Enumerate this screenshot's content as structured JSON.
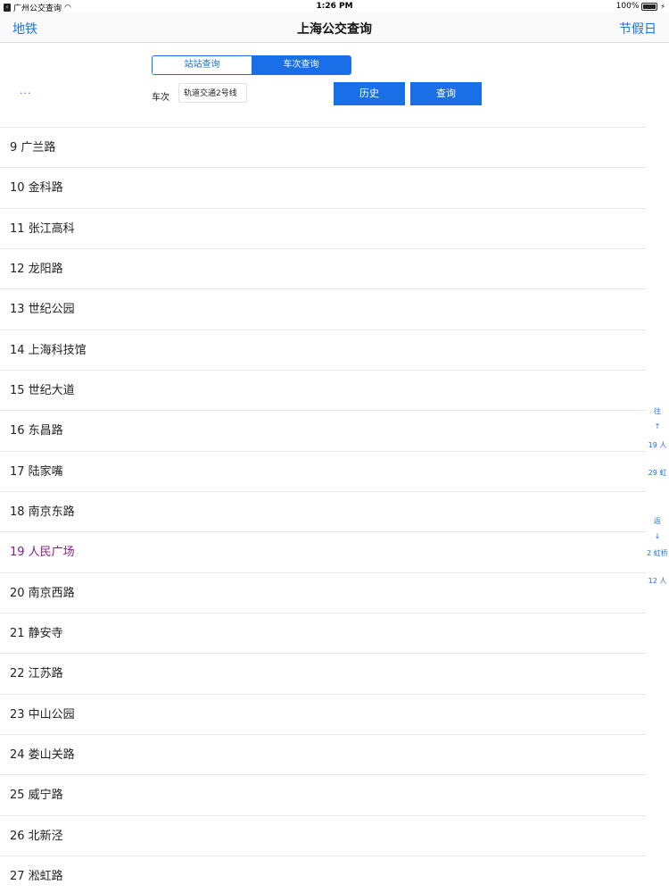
{
  "status_bar": {
    "back_app": "广州公交查询",
    "time": "1:26 PM",
    "battery": "100%"
  },
  "nav": {
    "left": "地铁",
    "title": "上海公交查询",
    "right": "节假日"
  },
  "query": {
    "tabs": [
      {
        "label": "站站查询",
        "active": false
      },
      {
        "label": "车次查询",
        "active": true
      }
    ],
    "more": "···",
    "field_label": "车次",
    "field_value": "轨道交通2号线",
    "history_button": "历史",
    "search_button": "查询"
  },
  "stations": [
    {
      "label": "9 广兰路"
    },
    {
      "label": "10 金科路"
    },
    {
      "label": "11 张江高科"
    },
    {
      "label": "12 龙阳路"
    },
    {
      "label": "13 世纪公园"
    },
    {
      "label": "14 上海科技馆"
    },
    {
      "label": "15 世纪大道"
    },
    {
      "label": "16 东昌路"
    },
    {
      "label": "17 陆家嘴"
    },
    {
      "label": "18 南京东路"
    },
    {
      "label": "19 人民广场",
      "highlight": true
    },
    {
      "label": "20 南京西路"
    },
    {
      "label": "21 静安寺"
    },
    {
      "label": "22 江苏路"
    },
    {
      "label": "23 中山公园"
    },
    {
      "label": "24 娄山关路"
    },
    {
      "label": "25 威宁路"
    },
    {
      "label": "26 北新泾"
    },
    {
      "label": "27 淞虹路"
    }
  ],
  "side_index": {
    "outbound": "往",
    "up_arrow": "↑",
    "item1": "19 人",
    "item2": "29 虹",
    "return": "返",
    "down_arrow": "↓",
    "item3": "2 虹桥",
    "item4": "12 人"
  },
  "colors": {
    "accent": "#1a6fe8",
    "highlight": "#8b1a8b"
  }
}
